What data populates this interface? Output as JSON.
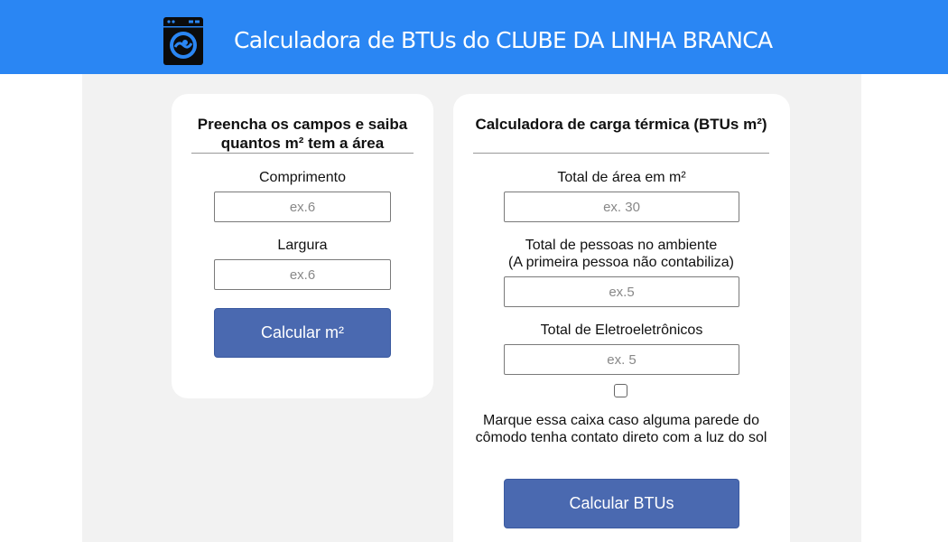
{
  "header": {
    "title": "Calculadora de BTUs do CLUBE DA LINHA BRANCA",
    "logo_icon": "washing-machine-icon",
    "accent_color": "#2a86f3"
  },
  "area_card": {
    "title": "Preencha os campos e saiba quantos m² tem a área",
    "length": {
      "label": "Comprimento",
      "placeholder": "ex.6",
      "value": ""
    },
    "width": {
      "label": "Largura",
      "placeholder": "ex.6",
      "value": ""
    },
    "button_label": "Calcular m²"
  },
  "btu_card": {
    "title": "Calculadora de carga térmica (BTUs m²)",
    "area": {
      "label": "Total de área em m²",
      "placeholder": "ex. 30",
      "value": ""
    },
    "people": {
      "label_line1": "Total de pessoas no ambiente",
      "label_line2": "(A primeira pessoa não contabiliza)",
      "placeholder": "ex.5",
      "value": ""
    },
    "electronics": {
      "label": "Total de Eletroeletrônicos",
      "placeholder": "ex. 5",
      "value": ""
    },
    "sun_checkbox_checked": false,
    "sun_note": "Marque essa caixa caso alguma parede do cômodo tenha contato direto com a luz do sol",
    "button_label": "Calcular BTUs"
  },
  "colors": {
    "button": "#4a69b0",
    "page_background": "#f2f2f2"
  }
}
